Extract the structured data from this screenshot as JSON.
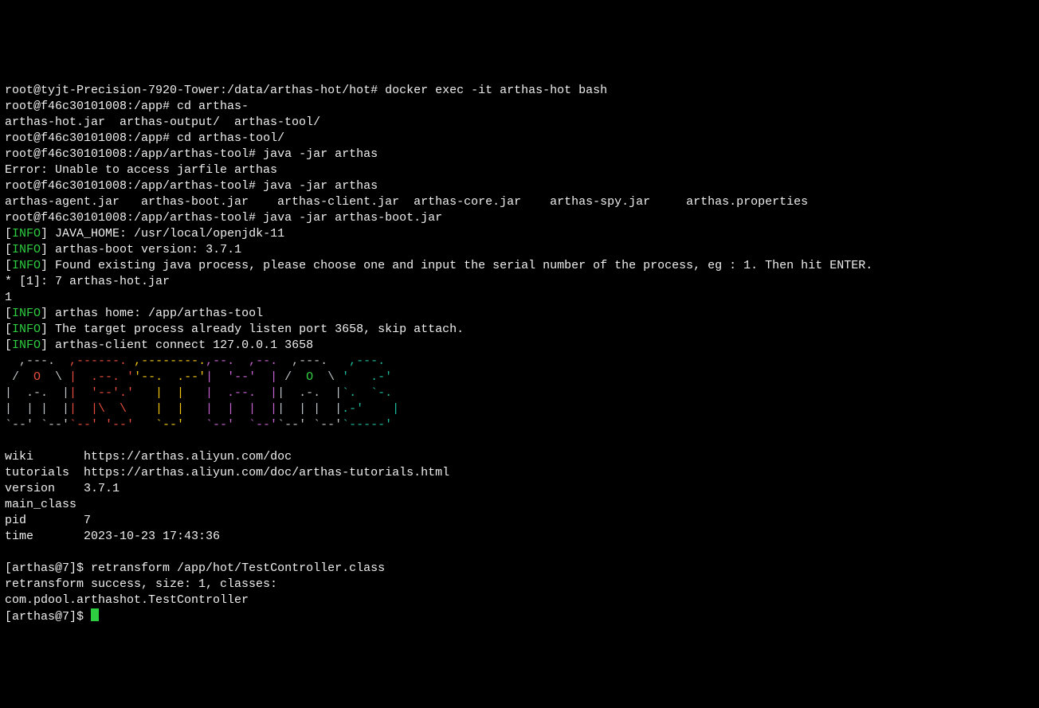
{
  "lines": {
    "l1_prompt": "root@tyjt-Precision-7920-Tower:/data/arthas-hot/hot#",
    "l1_cmd": " docker exec -it arthas-hot bash",
    "l2_prompt": "root@f46c30101008:/app#",
    "l2_cmd": " cd arthas-",
    "l3": "arthas-hot.jar  arthas-output/  arthas-tool/",
    "l4_prompt": "root@f46c30101008:/app#",
    "l4_cmd": " cd arthas-tool/",
    "l5_prompt": "root@f46c30101008:/app/arthas-tool#",
    "l5_cmd": " java -jar arthas",
    "l6": "Error: Unable to access jarfile arthas",
    "l7_prompt": "root@f46c30101008:/app/arthas-tool#",
    "l7_cmd": " java -jar arthas",
    "l8": "arthas-agent.jar   arthas-boot.jar    arthas-client.jar  arthas-core.jar    arthas-spy.jar     arthas.properties",
    "l9_prompt": "root@f46c30101008:/app/arthas-tool#",
    "l9_cmd": " java -jar arthas-boot.jar",
    "info1": "] JAVA_HOME: /usr/local/openjdk-11",
    "info2": "] arthas-boot version: 3.7.1",
    "info3": "] Found existing java process, please choose one and input the serial number of the process, eg : 1. Then hit ENTER.",
    "proc": "* [1]: 7 arthas-hot.jar",
    "input1": "1",
    "info4": "] arthas home: /app/arthas-tool",
    "info5": "] The target process already listen port 3658, skip attach.",
    "info6": "] arthas-client connect 127.0.0.1 3658",
    "meta": {
      "wiki_lbl": "wiki",
      "wiki_val": "https://arthas.aliyun.com/doc",
      "tut_lbl": "tutorials",
      "tut_val": "https://arthas.aliyun.com/doc/arthas-tutorials.html",
      "ver_lbl": "version",
      "ver_val": "3.7.1",
      "mc_lbl": "main_class",
      "pid_lbl": "pid",
      "pid_val": "7",
      "time_lbl": "time",
      "time_val": "2023-10-23 17:43:36"
    },
    "p2_prompt": "[arthas@7]$",
    "p2_cmd": " retransform /app/hot/TestController.class",
    "res1": "retransform success, size: 1, classes:",
    "res2": "com.pdool.arthashot.TestController",
    "p3_prompt": "[arthas@7]$ ",
    "info_label": "INFO",
    "bracket_open": "[",
    "pad11": "       ",
    "pad10": "    ",
    "pad9": "   ",
    "pad8": "  ",
    "pad7": "      ",
    "pad_pid": "        "
  }
}
